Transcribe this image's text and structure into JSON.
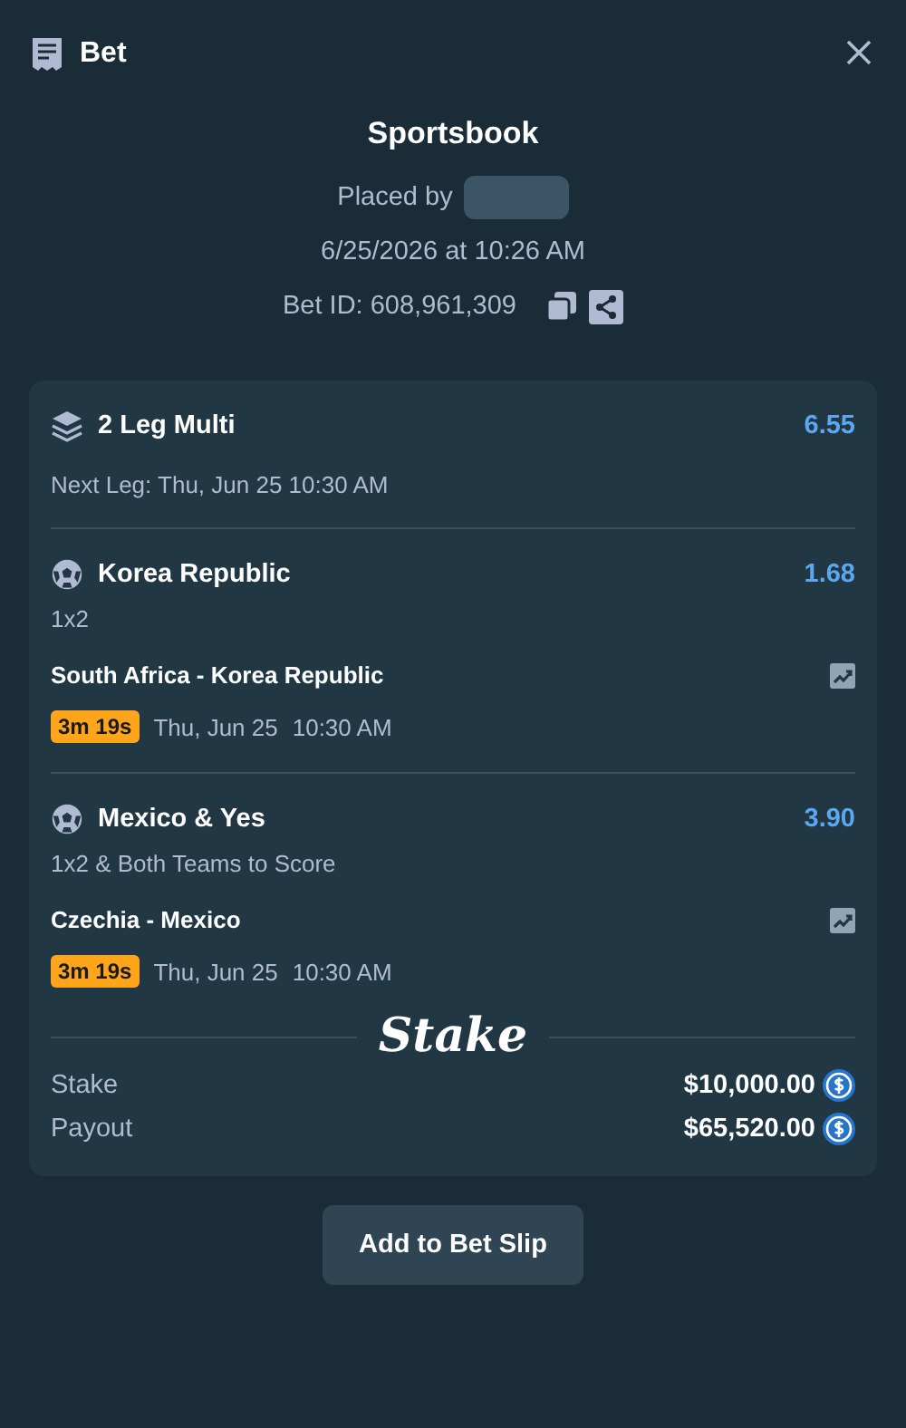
{
  "header": {
    "title": "Bet"
  },
  "summary": {
    "title": "Sportsbook",
    "placed_by": "Placed by",
    "date": "6/25/2026 at 10:26 AM",
    "bet_id": "Bet ID: 608,961,309"
  },
  "multi": {
    "title": "2 Leg Multi",
    "odds": "6.55",
    "next_leg": "Next Leg: Thu, Jun 25 10:30 AM"
  },
  "legs": [
    {
      "selection": "Korea Republic",
      "odds": "1.68",
      "market": "1x2",
      "match": "South Africa - Korea Republic",
      "countdown": "3m 19s",
      "date": "Thu, Jun 25",
      "time": "10:30 AM"
    },
    {
      "selection": "Mexico & Yes",
      "odds": "3.90",
      "market": "1x2 & Both Teams to Score",
      "match": "Czechia - Mexico",
      "countdown": "3m 19s",
      "date": "Thu, Jun 25",
      "time": "10:30 AM"
    }
  ],
  "brand": "Stake",
  "totals": [
    {
      "label": "Stake",
      "amount": "$10,000.00"
    },
    {
      "label": "Payout",
      "amount": "$65,520.00"
    }
  ],
  "action": "Add to Bet Slip"
}
